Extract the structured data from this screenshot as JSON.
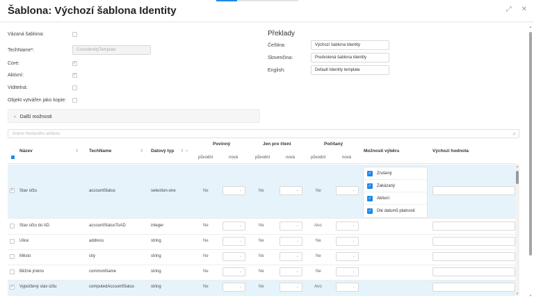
{
  "dialog": {
    "title": "Šablona: Výchozí šablona Identity"
  },
  "form": {
    "bound_label": "Vázaná šablona:",
    "techname_label": "TechName*:",
    "techname_placeholder": "CoreIdentityTemplate",
    "core_label": "Core:",
    "active_label": "Aktivní:",
    "visible_label": "Viditelná:",
    "copy_label": "Objekt vytvářen jako kopie:",
    "more_options": "Další možnosti"
  },
  "translations": {
    "heading": "Překlady",
    "rows": [
      {
        "label": "Čeština:",
        "value": "Výchozí šablona Identity"
      },
      {
        "label": "Slovenčina:",
        "value": "Predvolená šablona Identity"
      },
      {
        "label": "English:",
        "value": "Default Identity template"
      }
    ]
  },
  "search": {
    "placeholder": "Jméno hledaného atributu"
  },
  "grid": {
    "headers": {
      "name": "Název",
      "techname": "TechName",
      "datatype": "Datový typ",
      "required": "Povinný",
      "readonly": "Jen pro čtení",
      "computed": "Počítaný",
      "selection": "Možnosti výběru",
      "default": "Výchozí hodnota",
      "original": "původní",
      "new": "nová"
    },
    "rows": [
      {
        "name": "Stav účtu",
        "techname": "accountStatus",
        "type": "selection-one",
        "req": "Ne",
        "ro": "Ne",
        "comp": "Ne",
        "checked": true
      },
      {
        "name": "Stav účtu do AD",
        "techname": "accountStatusToAD",
        "type": "integer",
        "req": "Ne",
        "ro": "Ne",
        "comp": "Ano",
        "checked": false
      },
      {
        "name": "Ulice",
        "techname": "address",
        "type": "string",
        "req": "Ne",
        "ro": "Ne",
        "comp": "Ne",
        "checked": false
      },
      {
        "name": "Město",
        "techname": "city",
        "type": "string",
        "req": "Ne",
        "ro": "Ne",
        "comp": "Ne",
        "checked": false
      },
      {
        "name": "Běžné jméno",
        "techname": "commonName",
        "type": "string",
        "req": "Ne",
        "ro": "Ne",
        "comp": "Ne",
        "checked": false
      },
      {
        "name": "Vypočtený stav účtu",
        "techname": "computedAccountStatus",
        "type": "string",
        "req": "Ne",
        "ro": "Ne",
        "comp": "Ano",
        "checked": true
      }
    ],
    "options": [
      "Zrušený",
      "Zakázaný",
      "Aktivní",
      "Dle datumů platnosti"
    ]
  },
  "colors": {
    "accent": "#1e88e5",
    "selected_row": "#e6f3fb"
  }
}
